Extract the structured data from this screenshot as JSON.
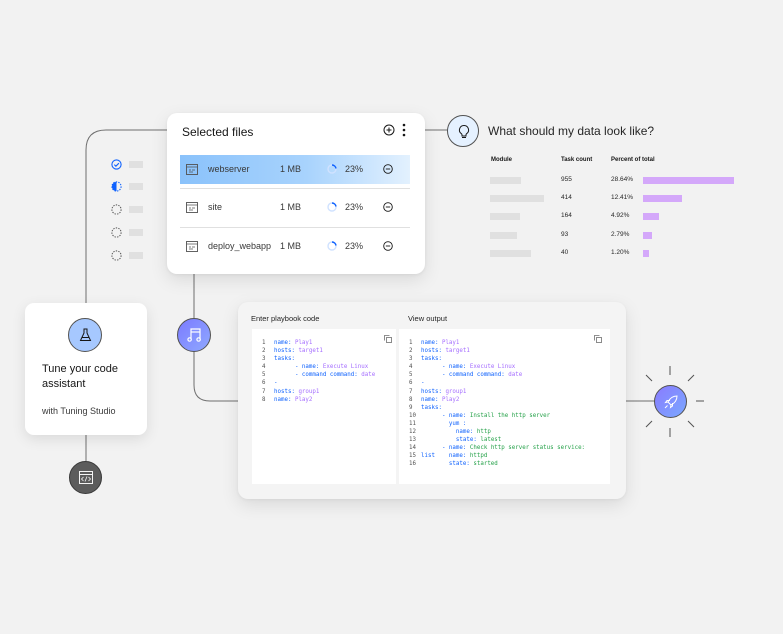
{
  "steps": [
    {
      "status": "complete",
      "icon": "checkmark-circle-icon"
    },
    {
      "status": "in-progress",
      "icon": "half-circle-icon"
    },
    {
      "status": "pending",
      "icon": "dashed-circle-icon"
    },
    {
      "status": "pending",
      "icon": "dashed-circle-icon"
    },
    {
      "status": "pending",
      "icon": "dashed-circle-icon"
    }
  ],
  "files_card": {
    "title": "Selected files",
    "add_icon": "add-circle-icon",
    "more_icon": "overflow-menu-icon",
    "files": [
      {
        "name": "webserver",
        "size": "1 MB",
        "progress": "23%",
        "progress_value": 0.23,
        "selected": true
      },
      {
        "name": "site",
        "size": "1 MB",
        "progress": "23%",
        "progress_value": 0.23,
        "selected": false
      },
      {
        "name": "deploy_webapp",
        "size": "1 MB",
        "progress": "23%",
        "progress_value": 0.23,
        "selected": false
      }
    ]
  },
  "data_look": {
    "title": "What should my data look like?",
    "icon": "lightbulb-icon",
    "columns": [
      "Module",
      "Task count",
      "Percent of total"
    ],
    "rows": [
      {
        "count": "955",
        "percent": "28.64%",
        "percent_value": 28.64
      },
      {
        "count": "414",
        "percent": "12.41%",
        "percent_value": 12.41
      },
      {
        "count": "164",
        "percent": "4.92%",
        "percent_value": 4.92
      },
      {
        "count": "93",
        "percent": "2.79%",
        "percent_value": 2.79
      },
      {
        "count": "40",
        "percent": "1.20%",
        "percent_value": 1.2
      }
    ]
  },
  "tune_card": {
    "icon": "flask-icon",
    "title": "Tune your code assistant",
    "subtitle": "with Tuning Studio"
  },
  "nodes": {
    "music": "music-note-icon",
    "code": "code-window-icon",
    "rocket": "rocket-icon"
  },
  "playbook": {
    "input_label": "Enter playbook code",
    "output_label": "View output",
    "input_lines": [
      {
        "n": "1",
        "parts": [
          [
            "k",
            "name: "
          ],
          [
            "v",
            "Play1"
          ]
        ]
      },
      {
        "n": "2",
        "parts": [
          [
            "k",
            "hosts: "
          ],
          [
            "v",
            "target1"
          ]
        ]
      },
      {
        "n": "3",
        "parts": [
          [
            "k",
            "tasks:"
          ]
        ]
      },
      {
        "n": "4",
        "parts": [
          [
            "k",
            "      - name: "
          ],
          [
            "v",
            "Execute Linux"
          ]
        ]
      },
      {
        "n": "5",
        "parts": [
          [
            "k",
            "      - command command: "
          ],
          [
            "v",
            "date"
          ]
        ]
      },
      {
        "n": "6",
        "parts": [
          [
            "k",
            "-"
          ]
        ]
      },
      {
        "n": "7",
        "parts": [
          [
            "k",
            "hosts: "
          ],
          [
            "v",
            "group1"
          ]
        ]
      },
      {
        "n": "8",
        "parts": [
          [
            "k",
            "name: "
          ],
          [
            "v",
            "Play2"
          ]
        ]
      }
    ],
    "output_lines": [
      {
        "n": "1",
        "parts": [
          [
            "k",
            "name: "
          ],
          [
            "v",
            "Play1"
          ]
        ]
      },
      {
        "n": "2",
        "parts": [
          [
            "k",
            "hosts: "
          ],
          [
            "v",
            "target1"
          ]
        ]
      },
      {
        "n": "3",
        "parts": [
          [
            "k",
            "tasks:"
          ]
        ]
      },
      {
        "n": "4",
        "parts": [
          [
            "k",
            "      - name: "
          ],
          [
            "v",
            "Execute Linux"
          ]
        ]
      },
      {
        "n": "5",
        "parts": [
          [
            "k",
            "      - command command: "
          ],
          [
            "v",
            "date"
          ]
        ]
      },
      {
        "n": "6",
        "parts": [
          [
            "k",
            "-"
          ]
        ]
      },
      {
        "n": "7",
        "parts": [
          [
            "k",
            "hosts: "
          ],
          [
            "v",
            "group1"
          ]
        ]
      },
      {
        "n": "8",
        "parts": [
          [
            "k",
            "name: "
          ],
          [
            "v",
            "Play2"
          ]
        ]
      },
      {
        "n": "9",
        "parts": [
          [
            "k",
            "tasks:"
          ]
        ]
      },
      {
        "n": "10",
        "parts": [
          [
            "k",
            "      - name: "
          ],
          [
            "g",
            "Install the http server"
          ]
        ]
      },
      {
        "n": "11",
        "parts": [
          [
            "k",
            "        yum :"
          ]
        ]
      },
      {
        "n": "12",
        "parts": [
          [
            "k",
            "          name: "
          ],
          [
            "g",
            "http"
          ]
        ]
      },
      {
        "n": "13",
        "parts": [
          [
            "k",
            "          state: "
          ],
          [
            "g",
            "latest"
          ]
        ]
      },
      {
        "n": "14",
        "parts": [
          [
            "k",
            "      - name: "
          ],
          [
            "g",
            "Check http server status service:"
          ]
        ]
      },
      {
        "n": "15",
        "parts": [
          [
            "k",
            "list    name: "
          ],
          [
            "g",
            "httpd"
          ]
        ]
      },
      {
        "n": "16",
        "parts": [
          [
            "k",
            "        state: "
          ],
          [
            "g",
            "started"
          ]
        ]
      }
    ],
    "copy_icon": "copy-icon"
  },
  "colors": {
    "accent_blue": "#0f62fe",
    "accent_purple": "#a56eff",
    "accent_green": "#24a148",
    "bar_purple": "#d4a8fa"
  }
}
